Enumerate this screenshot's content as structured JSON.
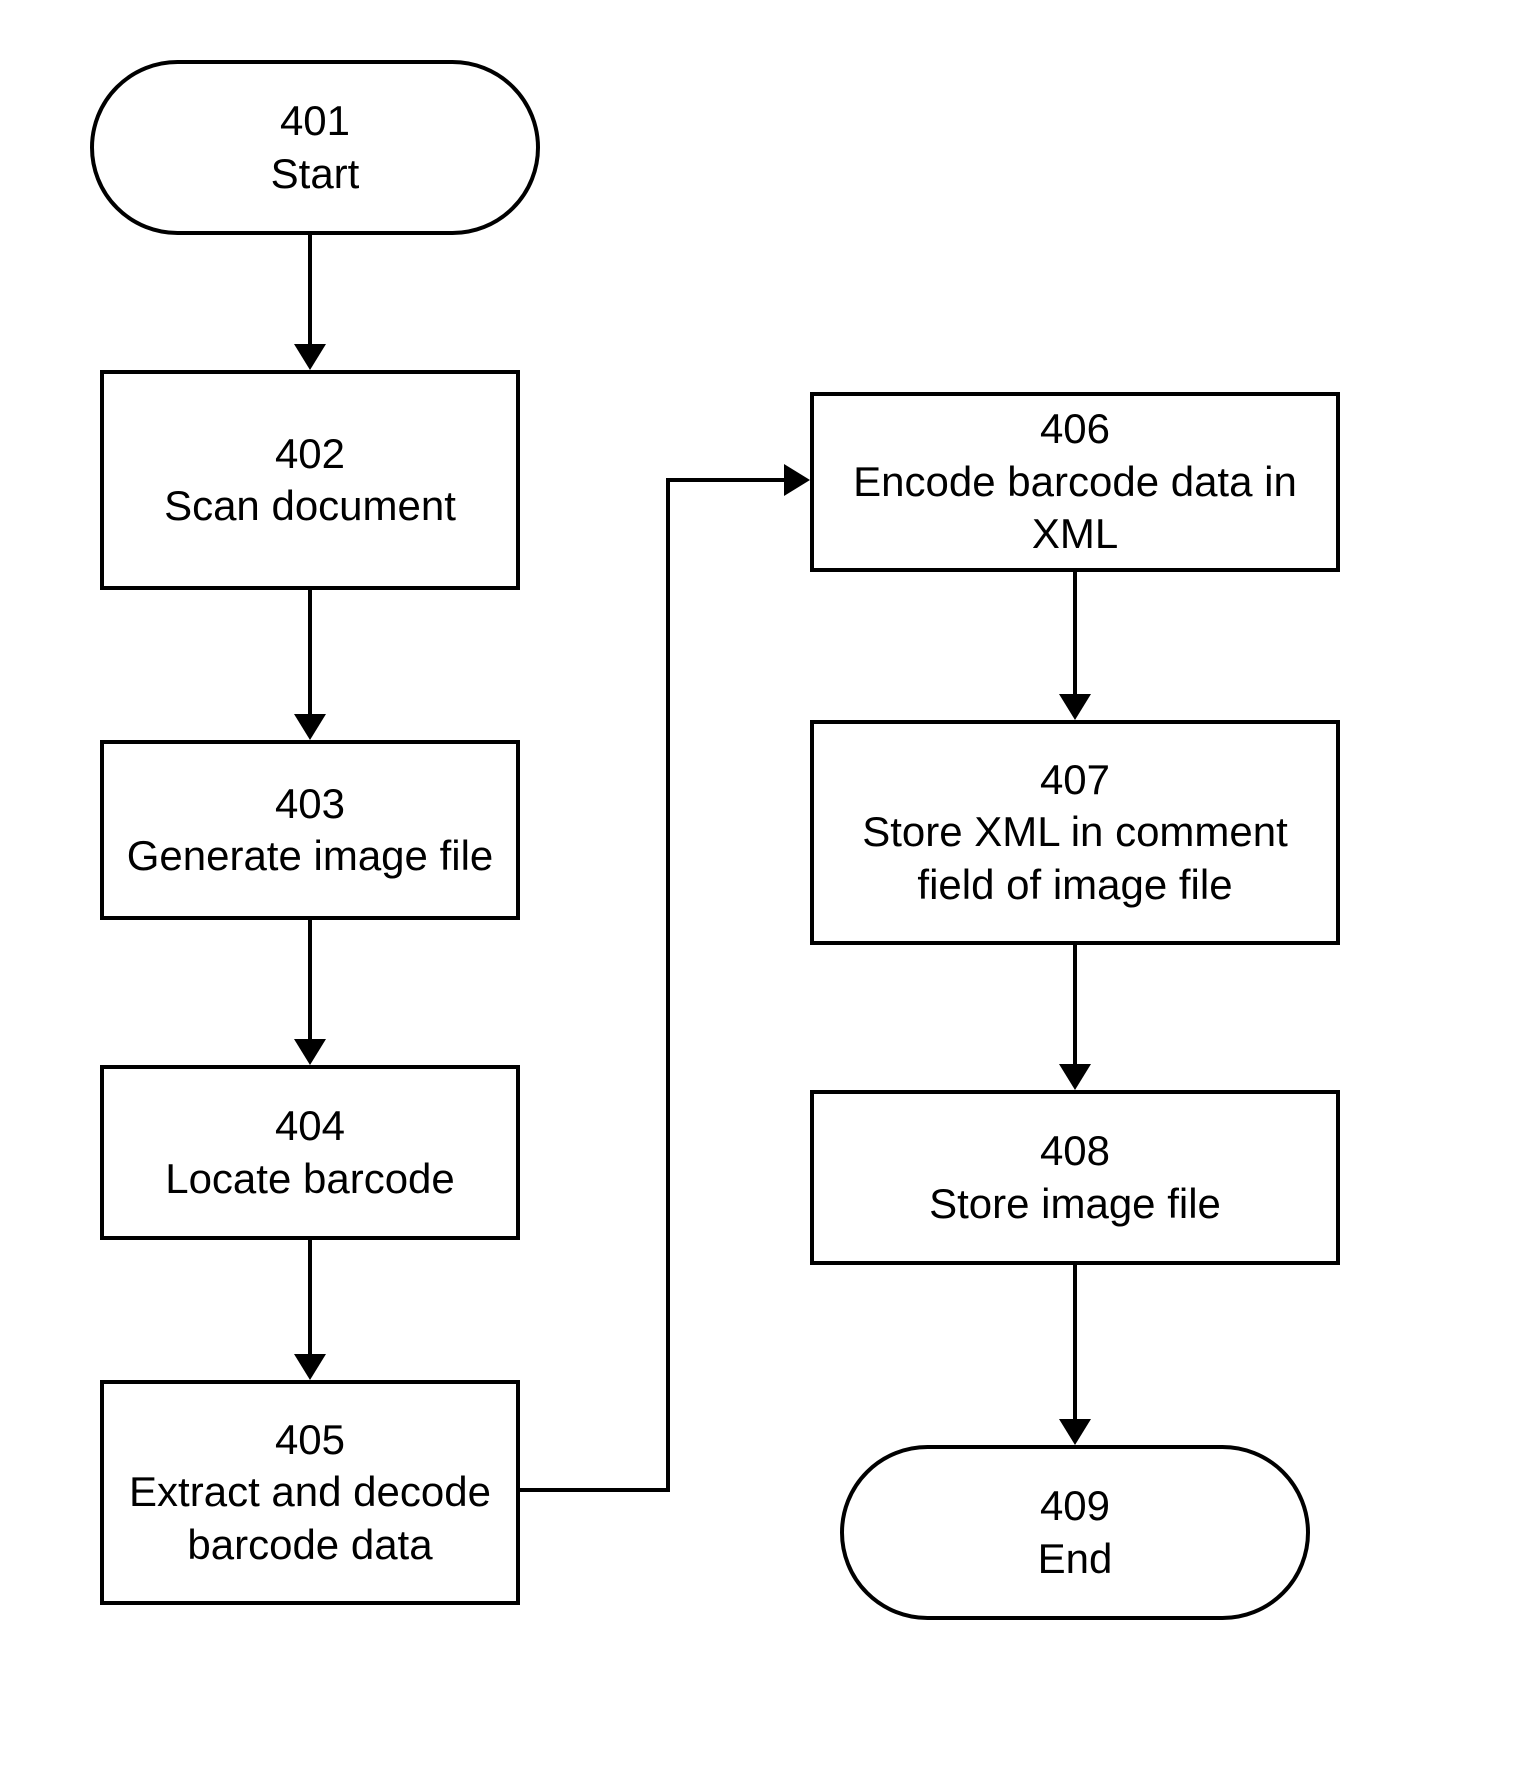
{
  "diagram": {
    "type": "flowchart",
    "nodes": {
      "n401": {
        "num": "401",
        "label": "Start",
        "shape": "terminator"
      },
      "n402": {
        "num": "402",
        "label": "Scan document",
        "shape": "process"
      },
      "n403": {
        "num": "403",
        "label": "Generate image file",
        "shape": "process"
      },
      "n404": {
        "num": "404",
        "label": "Locate barcode",
        "shape": "process"
      },
      "n405": {
        "num": "405",
        "label": "Extract and decode barcode data",
        "shape": "process"
      },
      "n406": {
        "num": "406",
        "label": "Encode barcode data in XML",
        "shape": "process"
      },
      "n407": {
        "num": "407",
        "label": "Store XML in comment field of image file",
        "shape": "process"
      },
      "n408": {
        "num": "408",
        "label": "Store image file",
        "shape": "process"
      },
      "n409": {
        "num": "409",
        "label": "End",
        "shape": "terminator"
      }
    },
    "edges": [
      {
        "from": "n401",
        "to": "n402"
      },
      {
        "from": "n402",
        "to": "n403"
      },
      {
        "from": "n403",
        "to": "n404"
      },
      {
        "from": "n404",
        "to": "n405"
      },
      {
        "from": "n405",
        "to": "n406"
      },
      {
        "from": "n406",
        "to": "n407"
      },
      {
        "from": "n407",
        "to": "n408"
      },
      {
        "from": "n408",
        "to": "n409"
      }
    ]
  }
}
